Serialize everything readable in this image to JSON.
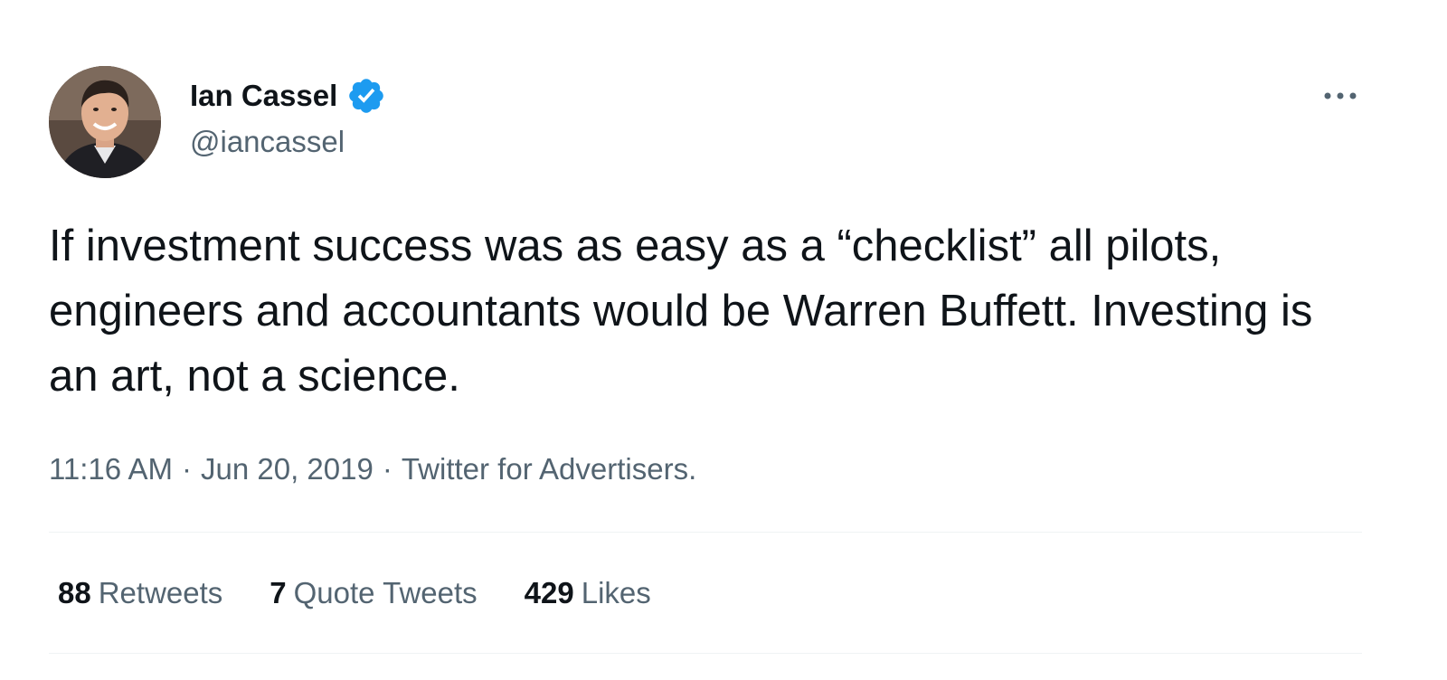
{
  "author": {
    "display_name": "Ian Cassel",
    "handle": "@iancassel",
    "verified": true,
    "avatar": "profile-photo"
  },
  "menu_icon": "more-horizontal-icon",
  "tweet": {
    "text": "If investment success was as easy as a “checklist” all pilots, engineers and accountants would be Warren Buffett. Investing is an art, not a science.",
    "time": "11:16 AM",
    "date": "Jun 20, 2019",
    "source": "Twitter for Advertisers.",
    "separator": "·"
  },
  "stats": [
    {
      "count": "88",
      "label": "Retweets"
    },
    {
      "count": "7",
      "label": "Quote Tweets"
    },
    {
      "count": "429",
      "label": "Likes"
    }
  ],
  "colors": {
    "text_primary": "#0f1419",
    "text_secondary": "#536471",
    "verified_badge": "#1d9bf0",
    "divider": "#eff3f4"
  }
}
